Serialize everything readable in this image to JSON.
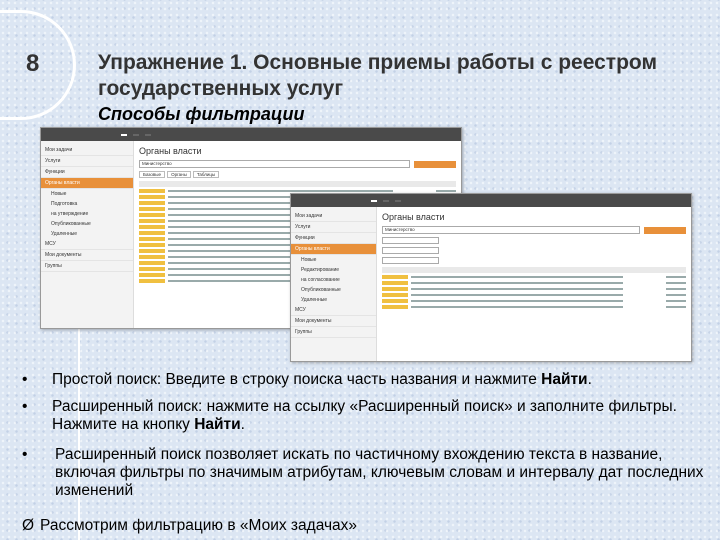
{
  "slide": {
    "number": "8",
    "title": "Упражнение 1. Основные приемы работы с реестром государственных услуг",
    "subtitle": "Способы фильтрации"
  },
  "screenshot1": {
    "heading": "Органы власти",
    "search_value": "Министерство",
    "tabs": [
      "Базовые",
      "Органы",
      "Таблицы"
    ],
    "sidebar": [
      "Мои задачи",
      "Услуги",
      "Функции",
      "Органы власти",
      "Новые",
      "Подготовка",
      "на утверждение",
      "Опубликованные",
      "Удаленные",
      "МСУ",
      "Мои документы",
      "Группы"
    ]
  },
  "screenshot2": {
    "heading": "Органы власти",
    "search_value": "Министерство",
    "sidebar": [
      "Мои задачи",
      "Услуги",
      "Функции",
      "Органы власти",
      "Новые",
      "Редактирование",
      "на согласование",
      "Опубликованные",
      "Удаленные",
      "МСУ",
      "Мои документы",
      "Группы"
    ]
  },
  "bullets": [
    {
      "marker": "•",
      "text": "Простой поиск: Введите в строку поиска часть названия  и нажмите ",
      "bold": "Найти",
      "end": "."
    },
    {
      "marker": "•",
      "text": "Расширенный поиск: нажмите на ссылку «Расширенный поиск» и заполните фильтры. Нажмите на кнопку ",
      "bold": "Найти",
      "end": "."
    },
    {
      "marker": "•",
      "text": "Расширенный поиск позволяет искать по частичному вхождению текста в название, включая фильтры по значимым атрибутам, ключевым словам и интервалу дат последних изменений",
      "bold": "",
      "end": ""
    },
    {
      "marker": "Ø",
      "text": "Рассмотрим фильтрацию в «Моих задачах»",
      "bold": "",
      "end": ""
    }
  ]
}
